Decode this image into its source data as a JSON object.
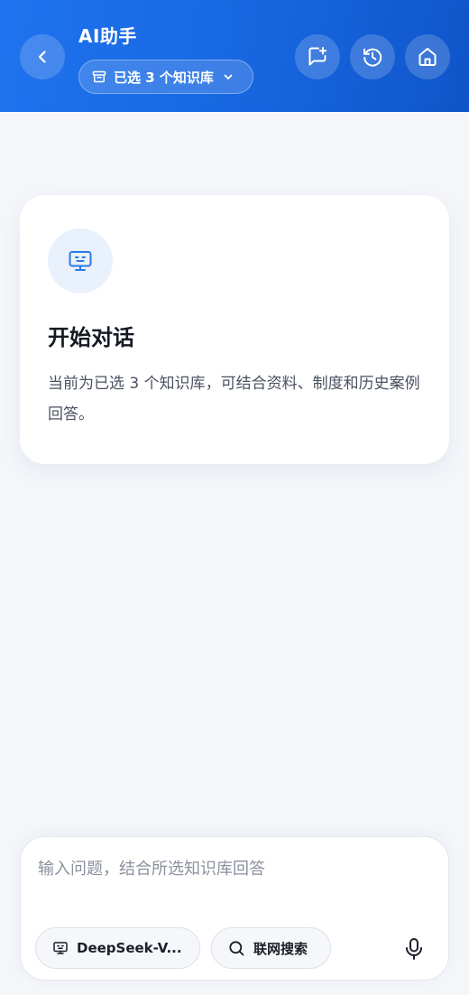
{
  "header": {
    "title": "AI助手",
    "kb_selector_label": "已选 3 个知识库",
    "back_icon": "chevron-left-icon",
    "new_chat_icon": "new-chat-icon",
    "history_icon": "history-icon",
    "home_icon": "home-icon"
  },
  "welcome": {
    "icon": "bot-monitor-icon",
    "title": "开始对话",
    "description": "当前为已选 3 个知识库，可结合资料、制度和历史案例回答。"
  },
  "composer": {
    "placeholder": "输入问题，结合所选知识库回答",
    "model_label": "DeepSeek-V...",
    "web_search_label": "联网搜索",
    "mic_icon": "microphone-icon"
  },
  "colors": {
    "brand_blue": "#1766e0",
    "card_bg": "#ffffff",
    "page_bg": "#f4f6fa"
  }
}
